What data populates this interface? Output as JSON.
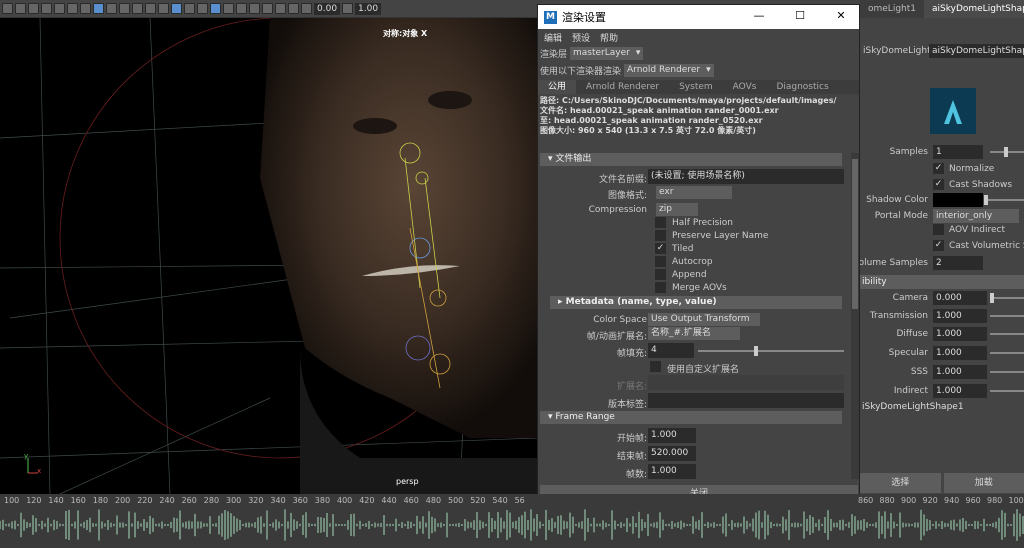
{
  "toolbar": {
    "value1": "0.00",
    "value2": "1.00"
  },
  "viewport": {
    "top_label": "对称:对象 X",
    "camera_label": "persp",
    "axis_y": "y",
    "axis_x": "x"
  },
  "right_panel": {
    "tabs": [
      "omeLight1",
      "aiSkyDomeLightShape1"
    ],
    "node_label": "iSkyDomeLight:",
    "node_value": "aiSkyDomeLightShape1",
    "samples_label": "Samples",
    "samples_value": "1",
    "normalize_label": "Normalize",
    "cast_shadows_label": "Cast Shadows",
    "shadow_color_label": "Shadow Color",
    "portal_mode_label": "Portal Mode",
    "portal_mode_value": "interior_only",
    "aov_indirect_label": "AOV Indirect",
    "cast_vol_label": "Cast Volumetric Sh",
    "vol_samples_label": "Volume Samples",
    "vol_samples_value": "2",
    "visibility_section": "ibility",
    "camera_label": "Camera",
    "camera_value": "0.000",
    "transmission_label": "Transmission",
    "transmission_value": "1.000",
    "diffuse_label": "Diffuse",
    "diffuse_value": "1.000",
    "specular_label": "Specular",
    "specular_value": "1.000",
    "sss_label": "SSS",
    "sss_value": "1.000",
    "indirect_label": "Indirect",
    "indirect_value": "1.000",
    "footer_name": "iSkyDomeLightShape1",
    "select_button": "选择",
    "load_button": "加载"
  },
  "dialog": {
    "logo": "M",
    "title": "渲染设置",
    "minimize": "—",
    "maximize": "☐",
    "close_x": "✕",
    "menu": [
      "编辑",
      "预设",
      "帮助"
    ],
    "layer_label": "渲染层",
    "layer_value": "masterLayer",
    "renderer_label": "使用以下渲染器渲染",
    "renderer_value": "Arnold Renderer",
    "tabs": [
      "公用",
      "Arnold Renderer",
      "System",
      "AOVs",
      "Diagnostics"
    ],
    "info": [
      "路径: C:/Users/SkinoDJC/Documents/maya/projects/default/images/",
      "文件名: head.00021_speak animation rander_0001.exr",
      "至: head.00021_speak animation rander_0520.exr",
      "图像大小: 960 x 540 (13.3 x 7.5 英寸 72.0 像素/英寸)"
    ],
    "file_output_section": "文件输出",
    "prefix_label": "文件名前缀:",
    "prefix_value": "(未设置; 使用场景名称)",
    "format_label": "图像格式:",
    "format_value": "exr",
    "compression_label": "Compression",
    "compression_value": "zip",
    "half_precision": "Half Precision",
    "preserve_layer": "Preserve Layer Name",
    "tiled": "Tiled",
    "autocrop": "Autocrop",
    "append": "Append",
    "merge_aovs": "Merge AOVs",
    "metadata_section": "Metadata (name, type, value)",
    "color_space_label": "Color Space",
    "color_space_value": "Use Output Transform",
    "frame_ext_label": "帧/动画扩展名:",
    "frame_ext_value": "名称_#.扩展名",
    "padding_label": "帧填充:",
    "padding_value": "4",
    "custom_ext_label": "使用自定义扩展名",
    "ext_label": "扩展名:",
    "version_label": "版本标签:",
    "frame_range_section": "Frame Range",
    "start_label": "开始帧:",
    "start_value": "1.000",
    "end_label": "结束帧:",
    "end_value": "520.000",
    "by_label": "帧数:",
    "by_value": "1.000",
    "close_button": "关闭"
  },
  "timeline": {
    "ticks": [
      "100",
      "120",
      "140",
      "160",
      "180",
      "200",
      "220",
      "240",
      "260",
      "280",
      "300",
      "320",
      "340",
      "360",
      "380",
      "400",
      "420",
      "440",
      "460",
      "480",
      "500",
      "520",
      "540",
      "56"
    ],
    "ticks_right": [
      "860",
      "880",
      "900",
      "920",
      "940",
      "960",
      "980",
      "100"
    ]
  }
}
